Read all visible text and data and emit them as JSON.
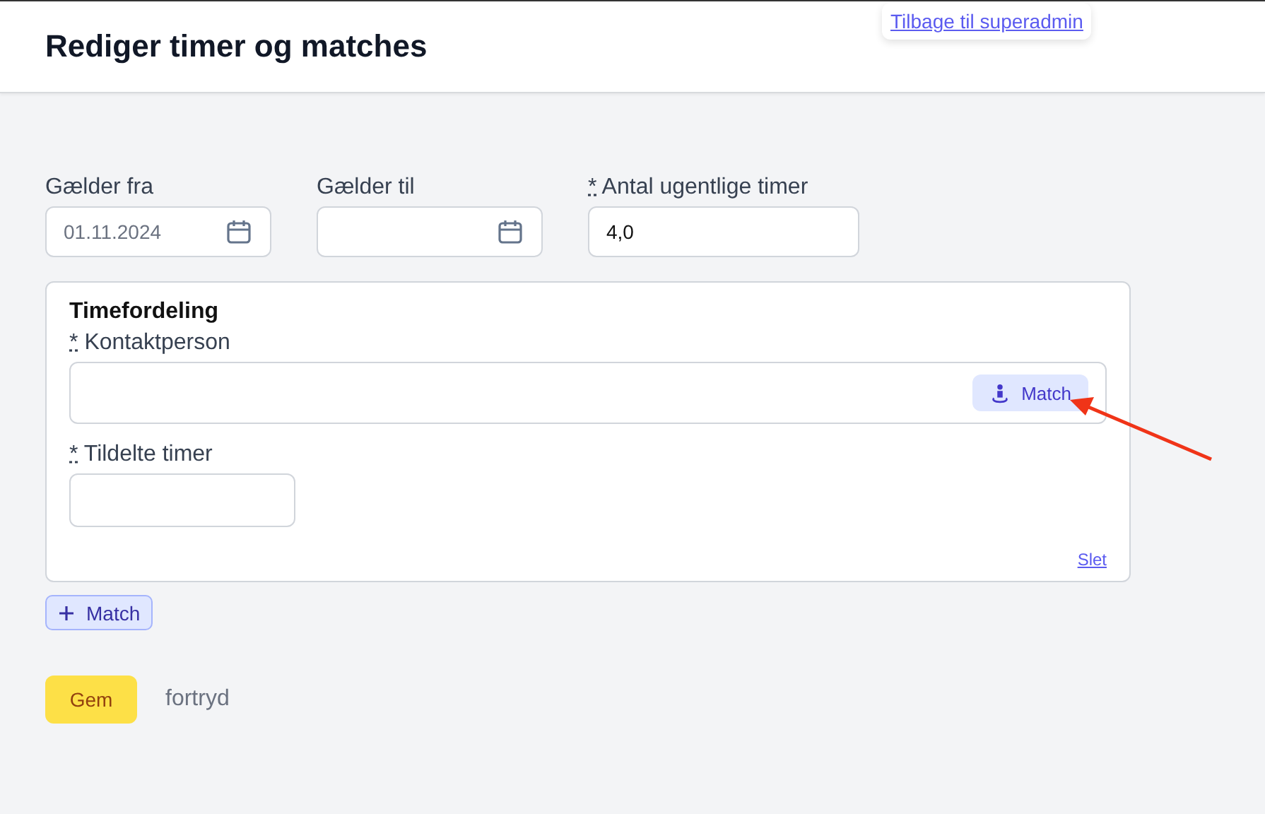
{
  "header": {
    "title": "Rediger timer og matches",
    "back_link": "Tilbage til superadmin"
  },
  "fields": [
    {
      "label": "Gælder fra",
      "kind": "date",
      "value": "01.11.2024"
    },
    {
      "label": "Gælder til",
      "kind": "date"
    },
    {
      "label": "Antal ugentlige timer",
      "required_mark": "*",
      "kind": "number",
      "value": "4,0"
    }
  ],
  "allocation": {
    "title": "Timefordeling",
    "contact": {
      "required_mark": "*",
      "label": "Kontaktperson",
      "match_button": "Match"
    },
    "hours": {
      "required_mark": "*",
      "label": "Tildelte timer"
    },
    "delete_link": "Slet"
  },
  "add_match_button": "Match",
  "actions": {
    "save": "Gem",
    "cancel": "fortryd"
  },
  "annotation": {
    "kind": "arrow"
  }
}
